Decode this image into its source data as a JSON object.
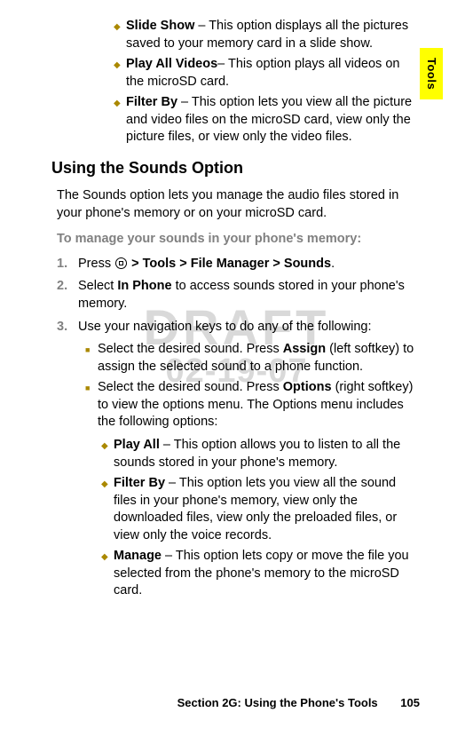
{
  "sideTab": {
    "label": "Tools"
  },
  "watermark": {
    "main": "DRAFT",
    "date": "02-19-07"
  },
  "topDiamonds": [
    {
      "term": "Slide Show",
      "sep": " – ",
      "desc": "This option displays all the pictures saved to your memory card in a slide show."
    },
    {
      "term": "Play All Videos",
      "sep": "– ",
      "desc": "This option plays all videos on the microSD card."
    },
    {
      "term": "Filter By",
      "sep": " – ",
      "desc": "This option lets you view all the picture and video files on the microSD card, view only the picture files, or view only the video files."
    }
  ],
  "heading": "Using the Sounds Option",
  "intro": "The Sounds option lets you manage the audio files stored in your phone's memory or on your microSD card.",
  "subheading": "To manage your sounds in your phone's memory:",
  "step1": {
    "num": "1.",
    "pre": "Press ",
    "post": "  > Tools > File Manager > Sounds",
    "tail": "."
  },
  "step2": {
    "num": "2.",
    "pre": "Select ",
    "bold": "In Phone",
    "post": " to access sounds stored in your phone's memory."
  },
  "step3": {
    "num": "3.",
    "text": "Use your navigation keys to do any of the following:"
  },
  "squares": [
    {
      "pre": "Select the desired sound. Press ",
      "bold": "Assign",
      "post": " (left softkey) to assign the selected sound to a phone function."
    },
    {
      "pre": "Select the desired sound. Press ",
      "bold": "Options",
      "post": " (right softkey) to view the options menu. The Options menu includes the following options:"
    }
  ],
  "lowerDiamonds": [
    {
      "term": "Play All",
      "sep": " – ",
      "desc": "This option allows you to listen to all the sounds stored in your phone's memory."
    },
    {
      "term": "Filter By",
      "sep": " – ",
      "desc": "This option lets you view all the sound files in your phone's memory, view only the downloaded files, view only the preloaded files, or view only the voice records."
    },
    {
      "term": "Manage",
      "sep": " – ",
      "desc": "This option lets copy or move the file you selected from the phone's memory to the microSD card."
    }
  ],
  "footer": {
    "section": "Section 2G: Using the Phone's Tools",
    "page": "105"
  }
}
